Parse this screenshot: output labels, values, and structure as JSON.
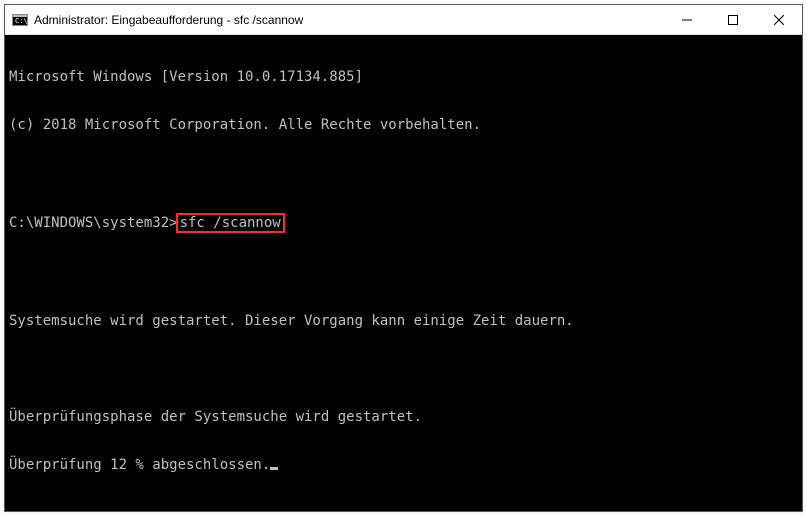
{
  "window": {
    "title": "Administrator: Eingabeaufforderung - sfc  /scannow"
  },
  "terminal": {
    "line1": "Microsoft Windows [Version 10.0.17134.885]",
    "line2": "(c) 2018 Microsoft Corporation. Alle Rechte vorbehalten.",
    "prompt_prefix": "C:\\WINDOWS\\system32>",
    "prompt_command": "sfc /scannow",
    "line4": "Systemsuche wird gestartet. Dieser Vorgang kann einige Zeit dauern.",
    "line5": "Überprüfungsphase der Systemsuche wird gestartet.",
    "line6": "Überprüfung 12 % abgeschlossen."
  }
}
